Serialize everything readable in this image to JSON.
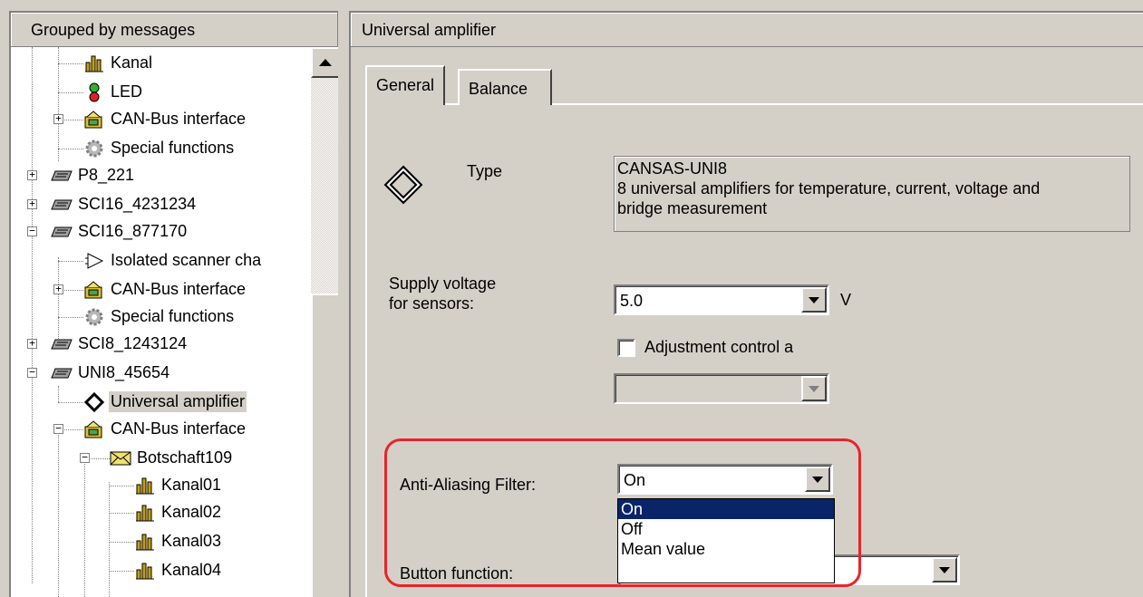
{
  "tree_header": "Grouped by messages",
  "tree": {
    "items": [
      {
        "label": "Kanal",
        "icon": "channel-bars-icon"
      },
      {
        "label": "LED",
        "icon": "led-icon"
      },
      {
        "label": "CAN-Bus interface",
        "icon": "can-bus-interface-icon"
      },
      {
        "label": "Special functions",
        "icon": "gear-icon"
      },
      {
        "label": "P8_221",
        "icon": "module-icon"
      },
      {
        "label": "SCI16_4231234",
        "icon": "module-icon"
      },
      {
        "label": "SCI16_877170",
        "icon": "module-icon"
      },
      {
        "label": "Isolated scanner cha",
        "icon": "isolated-scanner-icon"
      },
      {
        "label": "CAN-Bus interface",
        "icon": "can-bus-interface-icon"
      },
      {
        "label": "Special functions",
        "icon": "gear-icon"
      },
      {
        "label": "SCI8_1243124",
        "icon": "module-icon"
      },
      {
        "label": "UNI8_45654",
        "icon": "module-icon"
      },
      {
        "label": "Universal amplifier",
        "icon": "bridge-amplifier-icon"
      },
      {
        "label": "CAN-Bus interface",
        "icon": "can-bus-interface-icon"
      },
      {
        "label": "Botschaft109",
        "icon": "envelope-icon"
      },
      {
        "label": "Kanal01",
        "icon": "channel-bars-icon"
      },
      {
        "label": "Kanal02",
        "icon": "channel-bars-icon"
      },
      {
        "label": "Kanal03",
        "icon": "channel-bars-icon"
      },
      {
        "label": "Kanal04",
        "icon": "channel-bars-icon"
      }
    ]
  },
  "panel_title": "Universal amplifier",
  "tabs": [
    "General",
    "Balance"
  ],
  "general": {
    "type_label": "Type",
    "type_value_line1": "CANSAS-UNI8",
    "type_value_line2": "8 universal amplifiers for temperature, current, voltage and",
    "type_value_line3": "bridge measurement",
    "supply_label_line1": "Supply voltage",
    "supply_label_line2": "for sensors:",
    "supply_value": "5.0",
    "supply_unit": "V",
    "adjustment_label": "Adjustment control a",
    "adjustment_checked": false,
    "filter_label": "Anti-Aliasing Filter:",
    "filter_value": "On",
    "filter_options": [
      "On",
      "Off",
      "Mean value"
    ],
    "filter_selected_index": 0,
    "button_function_label": "Button function:"
  },
  "colors": {
    "selection": "#0a246a",
    "highlight": "#e8242c",
    "face": "#d4d0c8"
  }
}
